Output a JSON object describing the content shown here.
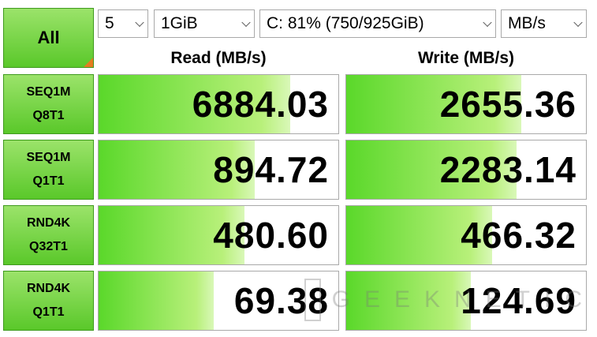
{
  "controls": {
    "all_label": "All",
    "count": "5",
    "size": "1GiB",
    "drive": "C: 81% (750/925GiB)",
    "unit": "MB/s"
  },
  "headers": {
    "read": "Read (MB/s)",
    "write": "Write (MB/s)"
  },
  "rows": [
    {
      "line1": "SEQ1M",
      "line2": "Q8T1",
      "read": "6884.03",
      "write": "2655.36",
      "read_fill": 0.8,
      "write_fill": 0.73
    },
    {
      "line1": "SEQ1M",
      "line2": "Q1T1",
      "read": "894.72",
      "write": "2283.14",
      "read_fill": 0.65,
      "write_fill": 0.71
    },
    {
      "line1": "RND4K",
      "line2": "Q32T1",
      "read": "480.60",
      "write": "466.32",
      "read_fill": 0.61,
      "write_fill": 0.61
    },
    {
      "line1": "RND4K",
      "line2": "Q1T1",
      "read": "69.38",
      "write": "124.69",
      "read_fill": 0.48,
      "write_fill": 0.52
    }
  ],
  "watermark": "GEEKNETIC",
  "colors": {
    "accent_green": "#5ac82a",
    "corner_orange": "#e57c21"
  }
}
